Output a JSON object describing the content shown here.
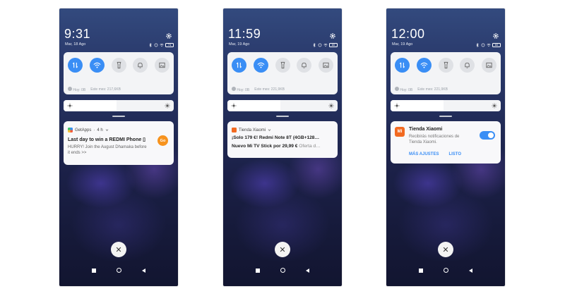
{
  "screens": [
    {
      "status": {
        "time": "9:31",
        "date": "Mar, 18 Ago",
        "battery": "74"
      },
      "quick_settings": {
        "usage_today": "Hoy: 0B",
        "usage_month": "Este mes: 217,6KB"
      },
      "brightness_level": 0.48,
      "notification": {
        "app": "GetApps",
        "age": "4 h",
        "title": "Last day to win a REDMI Phone ▯",
        "body": "HURRY! Join the August Dhamaka before it ends >>",
        "action": "Go"
      },
      "close": "✕"
    },
    {
      "status": {
        "time": "11:59",
        "date": "Mar, 19 Ago",
        "battery": "60"
      },
      "quick_settings": {
        "usage_today": "Hoy: 0B",
        "usage_month": "Este mes: 221,9KB"
      },
      "brightness_level": 0.48,
      "notification": {
        "app": "Tienda Xiaomi",
        "title": "¡Solo 179 €! Redmi Note 8T (4GB+128…",
        "line2": "Nuevo Mi TV Stick por 29,99 €",
        "line2_muted": "Oferta d…"
      },
      "close": "✕"
    },
    {
      "status": {
        "time": "12:00",
        "date": "Mar, 19 Ago",
        "battery": "60"
      },
      "quick_settings": {
        "usage_today": "Hoy: 0B",
        "usage_month": "Este mes: 221,9KB"
      },
      "brightness_level": 0.48,
      "notification": {
        "app_icon": "MI",
        "app": "Tienda Xiaomi",
        "body": "Recibirás notificaciones de Tienda Xiaomi.",
        "toggle_on": true,
        "action_more": "MÁS AJUSTES",
        "action_done": "LISTO"
      },
      "close": "✕"
    }
  ],
  "icons": {
    "gear": "gear-icon",
    "tiles": [
      "data-transfer-icon",
      "wifi-icon",
      "flashlight-icon",
      "bell-icon",
      "screenshot-icon"
    ]
  },
  "colors": {
    "accent": "#3a8ef5",
    "xiaomi_orange": "#f26a21",
    "go_orange": "#f7931e"
  }
}
